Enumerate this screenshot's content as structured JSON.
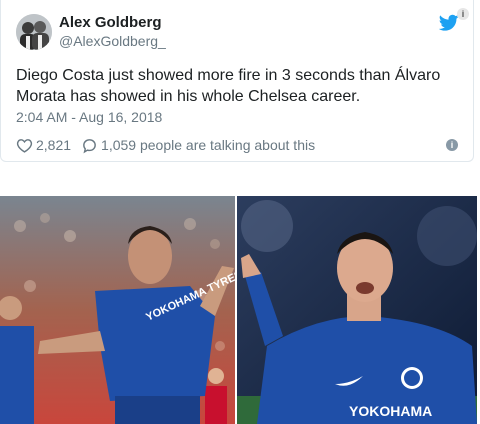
{
  "tweet": {
    "display_name": "Alex Goldberg",
    "handle": "@AlexGoldberg_",
    "text": "Diego Costa just showed more fire in 3 seconds than Álvaro Morata has showed in his whole Chelsea career.",
    "timestamp": "2:04 AM - Aug 16, 2018",
    "like_count": "2,821",
    "talking_text": "1,059 people are talking about this",
    "info_glyph": "i"
  },
  "photos": {
    "left_kit_sponsor": "YOKOHAMA TYRES",
    "right_kit_sponsor": "YOKOHAMA",
    "info_glyph": "i"
  },
  "colors": {
    "twitter_blue": "#1da1f2",
    "chelsea_blue": "#1f4fa8",
    "meta_gray": "#697882"
  },
  "icons": {
    "platform": "twitter-bird-icon",
    "like": "heart-icon",
    "reply": "speech-bubble-icon",
    "info": "info-icon"
  }
}
